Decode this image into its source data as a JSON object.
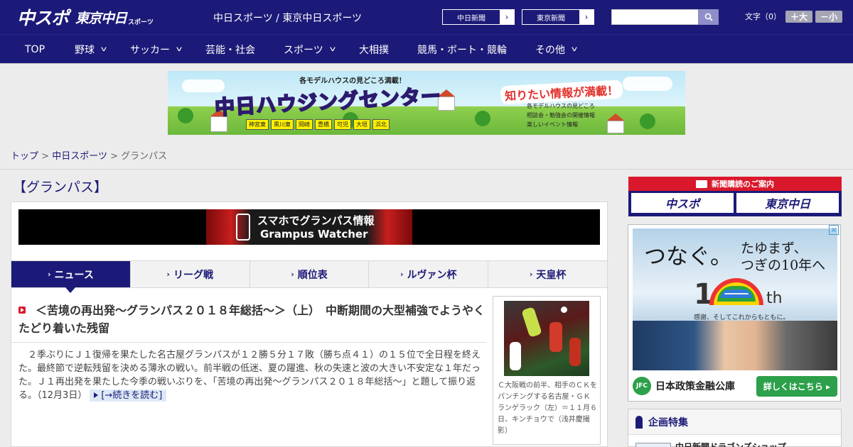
{
  "header": {
    "logo_main": "中スポ",
    "logo_sub": "東京中日",
    "logo_small": "スポーツ",
    "site_title": "中日スポーツ / 東京中日スポーツ",
    "ext_links": [
      "中日新聞",
      "東京新聞"
    ],
    "search_placeholder": "",
    "font_label": "文字（0）",
    "font_up": "＋大",
    "font_down": "－小"
  },
  "nav": {
    "items": [
      {
        "label": "TOP"
      },
      {
        "label": "野球"
      },
      {
        "label": "サッカー"
      },
      {
        "label": "芸能・社会"
      },
      {
        "label": "スポーツ"
      },
      {
        "label": "大相撲"
      },
      {
        "label": "競馬・ボート・競輪"
      },
      {
        "label": "その他"
      }
    ]
  },
  "banner": {
    "top_text": "各モデルハウスの見どころ満載！",
    "main_text": "中日ハウジングセンター",
    "right_text": "知りたい情報が満載！",
    "bullets": [
      "各モデルハウスの見どころ",
      "相談会・勉強会の開催情報",
      "楽しいイベント情報"
    ],
    "places": [
      "神宮東",
      "黒川東",
      "岡崎",
      "豊橋",
      "可児",
      "大垣",
      "浜北"
    ]
  },
  "breadcrumb": {
    "top": "トップ",
    "section": "中日スポーツ",
    "current": "グランパス",
    "sep": ">"
  },
  "main": {
    "category_title": "【グランパス】",
    "promo_line1": "スマホでグランパス情報",
    "promo_line2": "Grampus Watcher",
    "tabs": [
      {
        "label": "ニュース"
      },
      {
        "label": "リーグ戦"
      },
      {
        "label": "順位表"
      },
      {
        "label": "ルヴァン杯"
      },
      {
        "label": "天皇杯"
      }
    ],
    "headline": "＜苦境の再出発～グランパス２０１８年総括～＞（上）　中断期間の大型補強でようやくたどり着いた残留",
    "lead": "２季ぶりにＪ１復帰を果たした名古屋グランパスが１２勝５分１７敗（勝ち点４１）の１５位で全日程を終えた。最終節で逆転残留を決める薄氷の戦い。前半戦の低迷、夏の躍進、秋の失速と波の大きい不安定な１年だった。Ｊ１再出発を果たした今季の戦いぶりを、「苦境の再出発～グランパス２０１８年総括～」と題して振り返る。（12月3日）",
    "read_more": "[→続きを読む]",
    "photo_caption": "Ｃ大阪戦の前半、相手のＣＫをパンチングする名古屋・ＧＫランゲラック（左）＝１１月６日、キンチョウで（浅井慶撮影）"
  },
  "sidebar": {
    "subscribe_head": "新聞購読のご案内",
    "subscribe_btn1": "中スポ",
    "subscribe_btn2": "東京中日",
    "ad_text1": "つなぐ。",
    "ad_text2": "たゆまず、",
    "ad_text3": "つぎの10年へ",
    "ad_ten": "1",
    "ad_th": "th",
    "ad_tag": "感謝、そしてこれからもともに。",
    "ad_logo": "JFC",
    "ad_corp": "日本政策金融公庫",
    "ad_cta": "詳しくはこちら ▸",
    "ad_close": "✕",
    "feature_title": "企画特集",
    "feature_item": "中日新聞ドラゴンズショップ"
  }
}
